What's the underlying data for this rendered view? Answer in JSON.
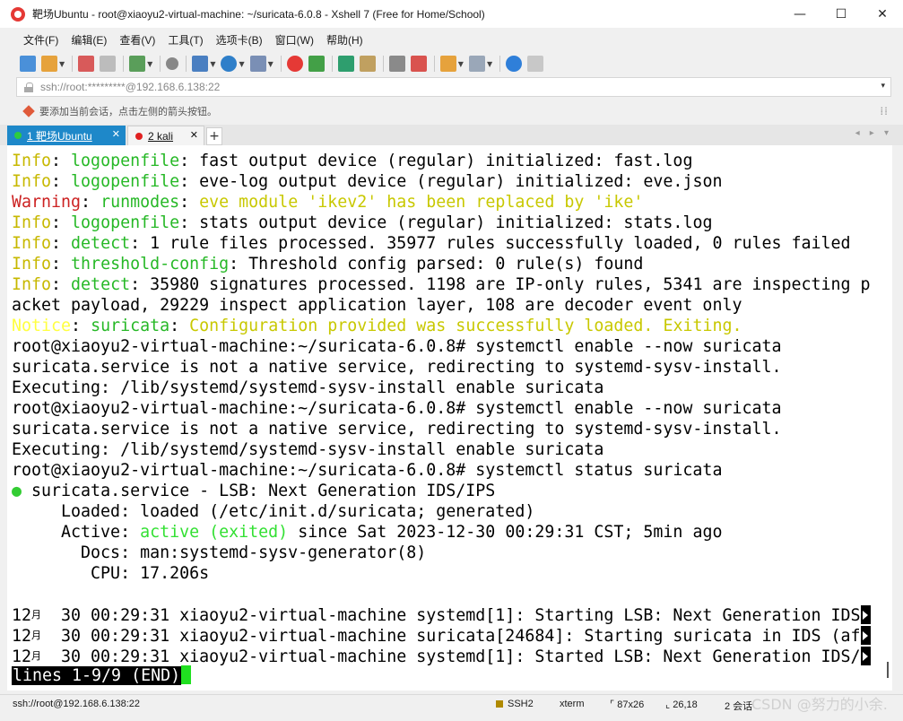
{
  "window": {
    "title": "靶场Ubuntu - root@xiaoyu2-virtual-machine: ~/suricata-6.0.8 - Xshell 7 (Free for Home/School)",
    "minimize": "—",
    "maximize": "☐",
    "close": "✕"
  },
  "menu": [
    "文件(F)",
    "编辑(E)",
    "查看(V)",
    "工具(T)",
    "选项卡(B)",
    "窗口(W)",
    "帮助(H)"
  ],
  "address": {
    "value": "ssh://root:*********@192.168.6.138:22",
    "dropdown": "▾"
  },
  "hint": {
    "text": "要添加当前会话，点击左侧的箭头按钮。",
    "dots": "⁞⁞"
  },
  "tabs": [
    {
      "label": "1 靶场Ubuntu",
      "dot_color": "#2ecc40",
      "close": "✕",
      "active": true
    },
    {
      "label": "2 kali",
      "dot_color": "#e02020",
      "close": "✕",
      "active": false
    }
  ],
  "tab_add": "+",
  "tab_nav": "◂ ▸ ▾",
  "terminal": {
    "lines": [
      [
        [
          "Info",
          "c-info"
        ],
        [
          ": ",
          ""
        ],
        [
          "logopenfile",
          "c-green"
        ],
        [
          ": fast output device (regular) initialized: fast.log",
          ""
        ]
      ],
      [
        [
          "Info",
          "c-info"
        ],
        [
          ": ",
          ""
        ],
        [
          "logopenfile",
          "c-green"
        ],
        [
          ": eve-log output device (regular) initialized: eve.json",
          ""
        ]
      ],
      [
        [
          "Warning",
          "c-warn"
        ],
        [
          ": ",
          ""
        ],
        [
          "runmodes",
          "c-green"
        ],
        [
          ": ",
          ""
        ],
        [
          "eve module 'ikev2' has been replaced by 'ike'",
          "c-yellow"
        ]
      ],
      [
        [
          "Info",
          "c-info"
        ],
        [
          ": ",
          ""
        ],
        [
          "logopenfile",
          "c-green"
        ],
        [
          ": stats output device (regular) initialized: stats.log",
          ""
        ]
      ],
      [
        [
          "Info",
          "c-info"
        ],
        [
          ": ",
          ""
        ],
        [
          "detect",
          "c-green"
        ],
        [
          ": 1 rule files processed. 35977 rules successfully loaded, 0 rules failed",
          ""
        ]
      ],
      [
        [
          "Info",
          "c-info"
        ],
        [
          ": ",
          ""
        ],
        [
          "threshold-config",
          "c-green"
        ],
        [
          ": Threshold config parsed: 0 rule(s) found",
          ""
        ]
      ],
      [
        [
          "Info",
          "c-info"
        ],
        [
          ": ",
          ""
        ],
        [
          "detect",
          "c-green"
        ],
        [
          ": 35980 signatures processed. 1198 are IP-only rules, 5341 are inspecting p",
          ""
        ]
      ],
      [
        [
          "acket payload, 29229 inspect application layer, 108 are decoder event only",
          ""
        ]
      ],
      [
        [
          "Notice",
          "c-notice"
        ],
        [
          ": ",
          ""
        ],
        [
          "suricata",
          "c-green"
        ],
        [
          ": ",
          ""
        ],
        [
          "Configuration provided was successfully loaded. Exiting.",
          "c-yellow"
        ]
      ],
      [
        [
          "root@xiaoyu2-virtual-machine:~/suricata-6.0.8# systemctl enable --now suricata",
          ""
        ]
      ],
      [
        [
          "suricata.service is not a native service, redirecting to systemd-sysv-install.",
          ""
        ]
      ],
      [
        [
          "Executing: /lib/systemd/systemd-sysv-install enable suricata",
          ""
        ]
      ],
      [
        [
          "root@xiaoyu2-virtual-machine:~/suricata-6.0.8# systemctl enable --now suricata",
          ""
        ]
      ],
      [
        [
          "suricata.service is not a native service, redirecting to systemd-sysv-install.",
          ""
        ]
      ],
      [
        [
          "Executing: /lib/systemd/systemd-sysv-install enable suricata",
          ""
        ]
      ],
      [
        [
          "root@xiaoyu2-virtual-machine:~/suricata-6.0.8# systemctl status suricata",
          ""
        ]
      ],
      [
        [
          "●",
          "c-dot"
        ],
        [
          " suricata.service - LSB: Next Generation IDS/IPS",
          ""
        ]
      ],
      [
        [
          "     Loaded: loaded (/etc/init.d/suricata; generated)",
          ""
        ]
      ],
      [
        [
          "     Active: ",
          ""
        ],
        [
          "active (exited)",
          "c-bright"
        ],
        [
          " since Sat 2023-12-30 00:29:31 CST; 5min ago",
          ""
        ]
      ],
      [
        [
          "       Docs: man:systemd-sysv-generator(8)",
          ""
        ]
      ],
      [
        [
          "        CPU: 17.206s",
          ""
        ]
      ],
      [
        [
          "",
          ""
        ]
      ],
      [
        [
          "12",
          ""
        ],
        [
          "月",
          "cn-small"
        ],
        [
          "  30 00:29:31 xiaoyu2-virtual-machine systemd[1]: Starting LSB: Next Generation IDS",
          ""
        ],
        [
          "",
          "cursor"
        ]
      ],
      [
        [
          "12",
          ""
        ],
        [
          "月",
          "cn-small"
        ],
        [
          "  30 00:29:31 xiaoyu2-virtual-machine suricata[24684]: Starting suricata in IDS (af",
          ""
        ],
        [
          "",
          "cursor"
        ]
      ],
      [
        [
          "12",
          ""
        ],
        [
          "月",
          "cn-small"
        ],
        [
          "  30 00:29:31 xiaoyu2-virtual-machine systemd[1]: Started LSB: Next Generation IDS/",
          ""
        ],
        [
          "",
          "cursor"
        ]
      ]
    ],
    "pager_prompt": "lines 1-9/9 (END)"
  },
  "status": {
    "connection": "ssh://root@192.168.6.138:22",
    "protocol": "SSH2",
    "term": "xterm",
    "size": "87x26",
    "position": "26,18",
    "sessions": "2 会话",
    "watermark": "CSDN @努力的小余."
  }
}
